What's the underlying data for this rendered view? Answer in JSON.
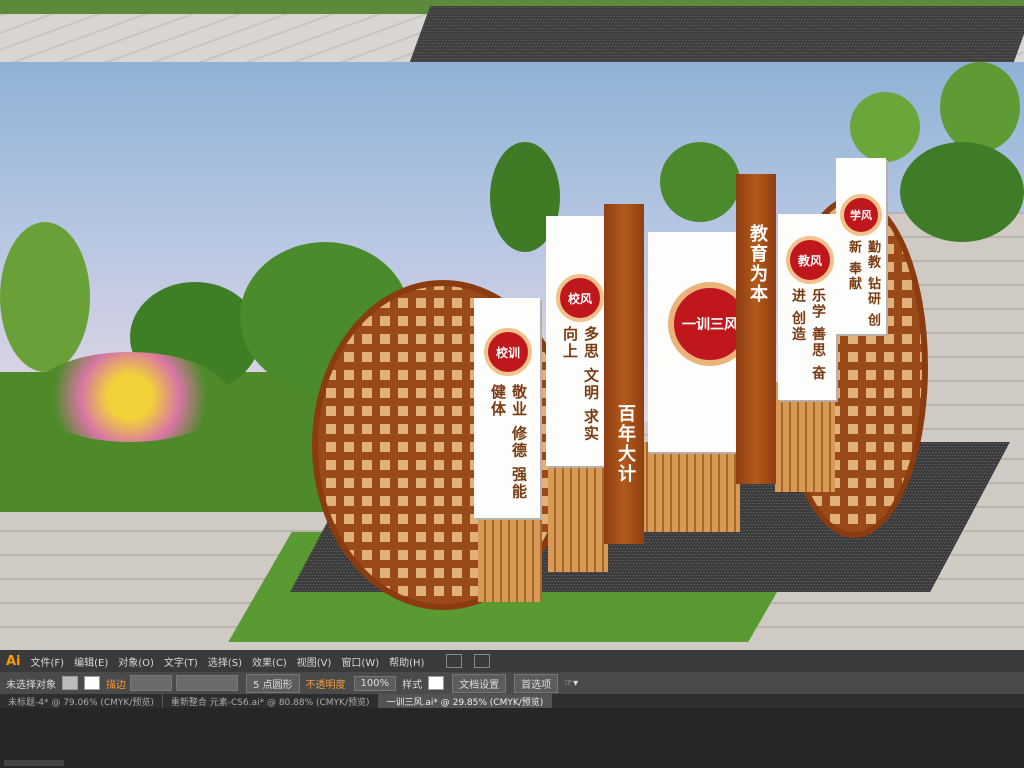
{
  "scene": {
    "signs": {
      "school_motto": {
        "badge": "校训",
        "text": "敬业 修德 强能 健体"
      },
      "school_spirit": {
        "badge": "校风",
        "text": "多思 文明 求实 向上"
      },
      "center_banner": "百年大计",
      "center_emblem": "一训三风",
      "education_banner": "教育为本",
      "teaching_spirit": {
        "badge": "教风",
        "text": "乐学 善思 奋进 创造"
      },
      "study_spirit": {
        "badge": "学风",
        "text": "勤教 钻研 创新 奉献"
      }
    }
  },
  "app": {
    "logo": "Ai"
  },
  "menu": [
    "文件(F)",
    "编辑(E)",
    "对象(O)",
    "文字(T)",
    "选择(S)",
    "效果(C)",
    "视图(V)",
    "窗口(W)",
    "帮助(H)"
  ],
  "control_bar": {
    "selection_status": "未选择对象",
    "stroke_label": "描边",
    "brush_point": "5 点圆形",
    "opacity_label": "不透明度",
    "opacity_value": "100%",
    "style_label": "样式",
    "document_setup": "文档设置",
    "preferences": "首选项"
  },
  "tabs": [
    {
      "label": "未标题-4* @ 79.06% (CMYK/预览)",
      "active": false
    },
    {
      "label": "重新整合 元素-CS6.ai* @ 80.88% (CMYK/预览)",
      "active": false
    },
    {
      "label": "一训三风.ai* @ 29.85% (CMYK/预览)",
      "active": true
    }
  ],
  "colors": {
    "accent": "#ff9a00",
    "sign_red": "#c0171c",
    "wood_brown": "#8f3e12"
  }
}
